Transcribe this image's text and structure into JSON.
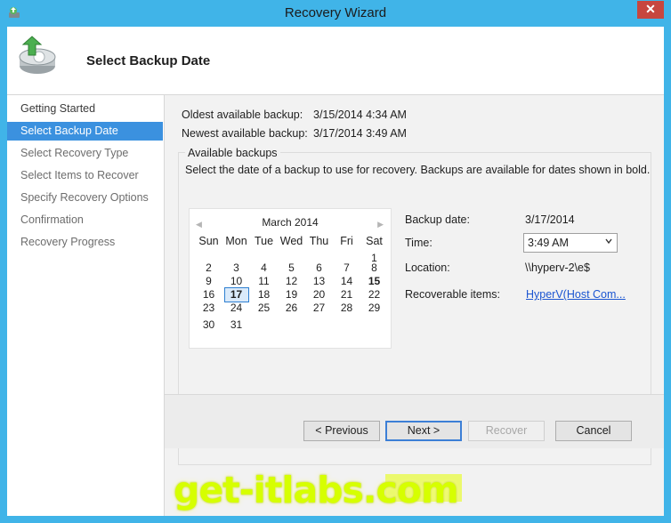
{
  "window": {
    "title": "Recovery Wizard",
    "close_glyph": "✕"
  },
  "header": {
    "title": "Select Backup Date",
    "icon": "backup-restore-icon"
  },
  "nav": {
    "items": [
      {
        "label": "Getting Started",
        "state": "done"
      },
      {
        "label": "Select Backup Date",
        "state": "active"
      },
      {
        "label": "Select Recovery Type",
        "state": "pending"
      },
      {
        "label": "Select Items to Recover",
        "state": "pending"
      },
      {
        "label": "Specify Recovery Options",
        "state": "pending"
      },
      {
        "label": "Confirmation",
        "state": "pending"
      },
      {
        "label": "Recovery Progress",
        "state": "pending"
      }
    ]
  },
  "summary": {
    "oldest_label": "Oldest available backup:",
    "oldest_value": "3/15/2014 4:34 AM",
    "newest_label": "Newest available backup:",
    "newest_value": "3/17/2014 3:49 AM"
  },
  "available": {
    "group_title": "Available backups",
    "description": "Select the date of a backup to use for recovery. Backups are available for dates shown in bold."
  },
  "calendar": {
    "prev": "◀",
    "next": "▶",
    "month": "March 2014",
    "weekdays": [
      "Sun",
      "Mon",
      "Tue",
      "Wed",
      "Thu",
      "Fri",
      "Sat"
    ],
    "weeks": [
      [
        "",
        "",
        "",
        "",
        "",
        "",
        "1"
      ],
      [
        "2",
        "3",
        "4",
        "5",
        "6",
        "7",
        "8"
      ],
      [
        "9",
        "10",
        "11",
        "12",
        "13",
        "14",
        "15"
      ],
      [
        "16",
        "17",
        "18",
        "19",
        "20",
        "21",
        "22"
      ],
      [
        "23",
        "24",
        "25",
        "26",
        "27",
        "28",
        "29"
      ],
      [
        "30",
        "31",
        "",
        "",
        "",
        "",
        ""
      ]
    ],
    "bold_dates": [
      "15",
      "17"
    ],
    "selected_date": "17"
  },
  "details": {
    "backup_date_label": "Backup date:",
    "backup_date_value": "3/17/2014",
    "time_label": "Time:",
    "time_value": "3:49 AM",
    "location_label": "Location:",
    "location_value": "\\\\hyperv-2\\e$",
    "recoverable_label": "Recoverable items:",
    "recoverable_value": "HyperV(Host Com..."
  },
  "buttons": {
    "previous": "< Previous",
    "next": "Next >",
    "recover": "Recover",
    "cancel": "Cancel"
  },
  "watermark": "get-itlabs.com",
  "colors": {
    "accent": "#3b91df",
    "titlebar": "#40b4e8",
    "watermark": "#d6ff00"
  }
}
